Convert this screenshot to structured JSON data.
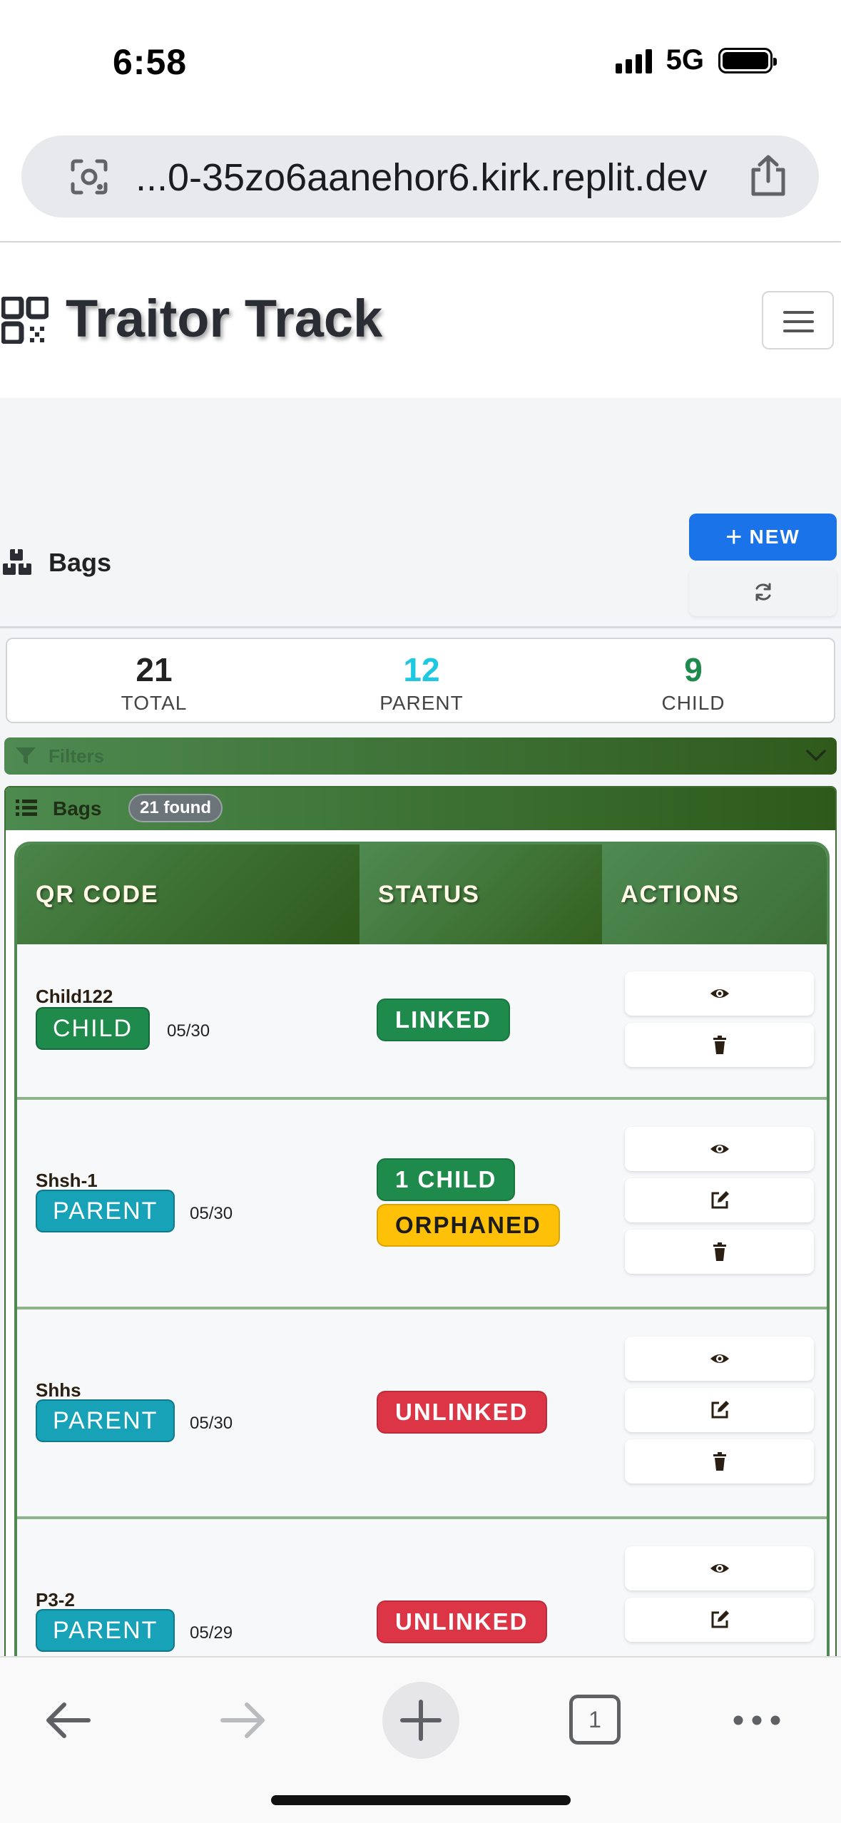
{
  "status_bar": {
    "time": "6:58",
    "network": "5G"
  },
  "browser": {
    "url": "...0-35zo6aanehor6.kirk.replit.dev",
    "tab_count": "1"
  },
  "app": {
    "brand": "Traitor Track"
  },
  "page": {
    "title": "Bags",
    "new_button": "NEW",
    "stats": [
      {
        "value": "21",
        "label": "TOTAL",
        "color": "#222222"
      },
      {
        "value": "12",
        "label": "PARENT",
        "color": "#1ec8e0"
      },
      {
        "value": "9",
        "label": "CHILD",
        "color": "#1e8a4c"
      }
    ],
    "filters_label": "Filters",
    "list_title": "Bags",
    "found_badge": "21 found"
  },
  "table": {
    "headers": {
      "qr": "QR CODE",
      "status": "STATUS",
      "actions": "ACTIONS"
    },
    "rows": [
      {
        "qr": "Child122",
        "type": "CHILD",
        "date": "05/30",
        "status": [
          {
            "text": "LINKED",
            "kind": "linked"
          }
        ],
        "actions": [
          "view",
          "delete"
        ]
      },
      {
        "qr": "Shsh-1",
        "type": "PARENT",
        "date": "05/30",
        "status": [
          {
            "text": "1 CHILD",
            "kind": "linked"
          },
          {
            "text": "ORPHANED",
            "kind": "orphan"
          }
        ],
        "actions": [
          "view",
          "edit",
          "delete"
        ]
      },
      {
        "qr": "Shhs",
        "type": "PARENT",
        "date": "05/30",
        "status": [
          {
            "text": "UNLINKED",
            "kind": "unlinked"
          }
        ],
        "actions": [
          "view",
          "edit",
          "delete"
        ]
      },
      {
        "qr": "P3-2",
        "type": "PARENT",
        "date": "05/29",
        "status": [
          {
            "text": "UNLINKED",
            "kind": "unlinked"
          }
        ],
        "actions": [
          "view",
          "edit"
        ]
      }
    ]
  },
  "colors": {
    "primary": "#1a73e8",
    "green": "#1e8a4c",
    "teal": "#17a2b8",
    "danger": "#dc3545",
    "warning": "#ffc107",
    "header_green": "#2e5a1b"
  }
}
